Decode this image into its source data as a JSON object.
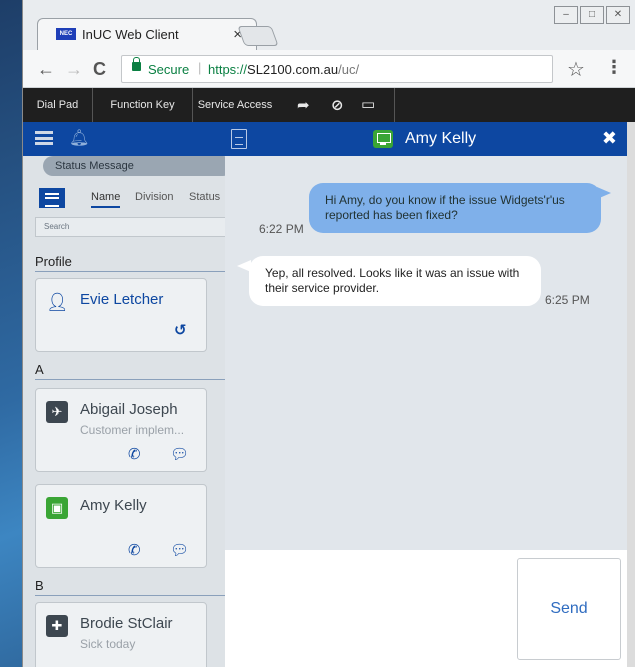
{
  "browser": {
    "favicon_text": "NEC",
    "tab_title": "InUC Web Client",
    "tab_close": "×",
    "secure_label": "Secure",
    "url_scheme": "https://",
    "url_host": "SL2100.com.au",
    "url_path": "/uc/",
    "back": "←",
    "forward": "→",
    "reload": "C",
    "star": "☆",
    "menu": "⋮",
    "win_min": "–",
    "win_max": "□",
    "win_close": "✕"
  },
  "appbar": {
    "dial_pad": "Dial Pad",
    "function_key": "Function Key",
    "service_access": "Service Access",
    "icons": [
      "forward-arrow-icon",
      "block-icon",
      "laptop-icon"
    ]
  },
  "left_panel": {
    "status_message": "Status Message",
    "tabs": [
      "Name",
      "Division",
      "Status"
    ],
    "search_placeholder": "Search",
    "profile_heading": "Profile",
    "profile_name": "Evie Letcher",
    "sections": [
      {
        "letter": "A"
      },
      {
        "letter": "B"
      }
    ],
    "contacts": [
      {
        "name": "Abigail Joseph",
        "sub": "Customer implem...",
        "avatar_color": "#3d4750",
        "avatar_icon": "airplane-icon"
      },
      {
        "name": "Amy Kelly",
        "sub": "",
        "avatar_color": "#3aa535",
        "avatar_icon": "monitor-icon"
      },
      {
        "name": "Brodie StClair",
        "sub": "Sick today",
        "avatar_color": "#3d4750",
        "avatar_icon": "medical-icon"
      }
    ]
  },
  "chat": {
    "contact_name": "Amy Kelly",
    "close": "✖",
    "messages": [
      {
        "direction": "out",
        "text": "Hi Amy, do you know if the issue Widgets'r'us reported has been fixed?",
        "time": "6:22 PM"
      },
      {
        "direction": "in",
        "text": "Yep, all resolved. Looks like it was an issue with their service provider.",
        "time": "6:25 PM"
      }
    ],
    "send_label": "Send"
  },
  "colors": {
    "primary": "#0d47a1",
    "presence_green": "#3aa535",
    "outgoing_bubble": "#7fb0ea",
    "secure_green": "#0b8043"
  }
}
